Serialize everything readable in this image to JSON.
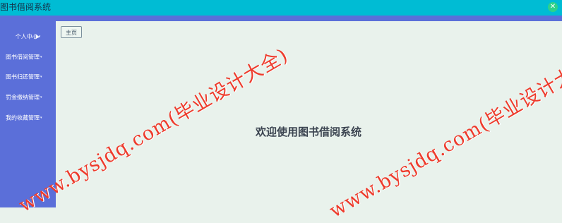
{
  "app": {
    "title": "图书借阅系统",
    "close_icon": "close-icon"
  },
  "sidebar": {
    "items": [
      {
        "label": "个人中心",
        "caret": "▾"
      },
      {
        "label": "图书借阅管理",
        "caret": "▾"
      },
      {
        "label": "图书归还管理",
        "caret": "▾"
      },
      {
        "label": "罚金缴纳管理",
        "caret": "▾"
      },
      {
        "label": "我的收藏管理",
        "caret": "▾"
      }
    ]
  },
  "tabs": [
    {
      "label": "主页"
    }
  ],
  "main": {
    "welcome_text": "欢迎使用图书借阅系统"
  },
  "watermark": {
    "text": "www.bysjdq.com(毕业设计大全)"
  },
  "colors": {
    "topbar": "#00bcd4",
    "sidebar": "#5b6fd9",
    "content_bg": "#e9f2ec",
    "watermark": "#ee3b2c"
  }
}
